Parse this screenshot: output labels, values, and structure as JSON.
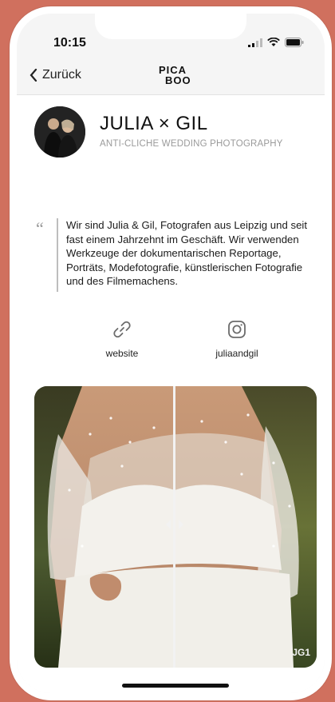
{
  "status": {
    "time": "10:15"
  },
  "nav": {
    "back_label": "Zurück",
    "logo_line1": "PICA",
    "logo_line2": "BOO"
  },
  "profile": {
    "name": "JULIA × GIL",
    "tagline": "ANTI-CLICHE WEDDING PHOTOGRAPHY"
  },
  "bio": {
    "quote_mark": "“",
    "text": "Wir sind Julia & Gil, Fotografen aus Leipzig und seit fast einem Jahrzehnt im Geschäft. Wir verwenden Werkzeuge der dokumentarischen Reportage, Porträts, Modefotografie, künstlerischen Fotografie und des Filmemachens."
  },
  "links": [
    {
      "label": "website",
      "icon": "link-icon"
    },
    {
      "label": "juliaandgil",
      "icon": "instagram-icon"
    }
  ],
  "gallery": {
    "watermark": "JG1"
  },
  "colors": {
    "background": "#d0705e",
    "accent_text": "#111111",
    "muted": "#9a9a9a"
  }
}
